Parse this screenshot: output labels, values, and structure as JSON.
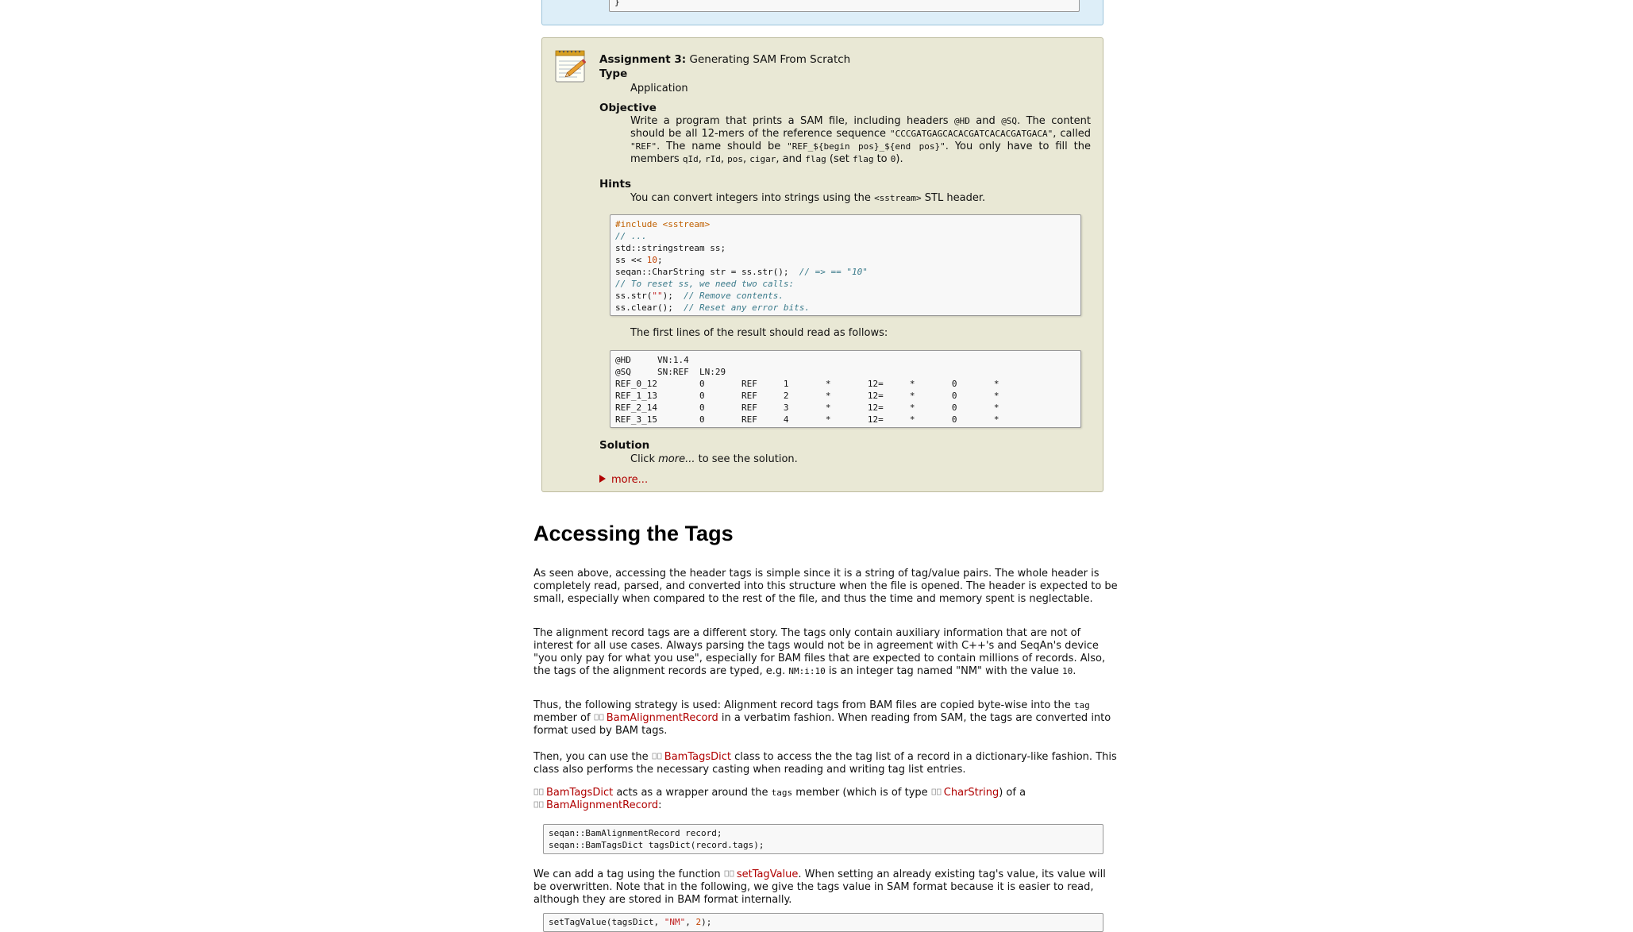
{
  "prev_code": {
    "closing": "}"
  },
  "assignment": {
    "title_bold": "Assignment 3:",
    "title_rest": " Generating SAM From Scratch",
    "type_label": "Type",
    "type_value": "Application",
    "objective_label": "Objective",
    "objective": {
      "t1": "Write a program that prints a SAM file, including headers ",
      "c1": "@HD",
      "t2": " and ",
      "c2": "@SQ",
      "t3": ". The content should be all 12-mers of the reference sequence ",
      "c3": "\"CCCGATGAGCACACGATCACACGATGACA\"",
      "t4": ", called ",
      "c4": "\"REF\"",
      "t5": ". The name should be ",
      "c5": "\"REF_${begin pos}_${end pos}\"",
      "t6": ". You only have to fill the members ",
      "c6": "qId",
      "t7": ", ",
      "c7": "rId",
      "t8": ", ",
      "c8": "pos",
      "t9": ", ",
      "c9": "cigar",
      "t10": ", and ",
      "c10": "flag",
      "t11": " (set ",
      "c11": "flag",
      "t12": " to ",
      "c12": "0",
      "t13": ")."
    },
    "hints_label": "Hints",
    "hints": {
      "t1": "You can convert integers into strings using the ",
      "c1": "<sstream>",
      "t2": " STL header."
    },
    "code1": {
      "l1": "#include <sstream>",
      "l2": "// ...",
      "l3": "std::stringstream ss;",
      "l4a": "ss << ",
      "l4n": "10",
      "l4b": ";",
      "l5a": "seqan::CharString str = ss.str();  ",
      "l5c": "// => == \"10\"",
      "l6": "// To reset ss, we need two calls:",
      "l7a": "ss.str(",
      "l7s": "\"\"",
      "l7b": ");  ",
      "l7c": "// Remove contents.",
      "l8a": "ss.clear();  ",
      "l8c": "// Reset any error bits."
    },
    "result_intro": "The first lines of the result should read as follows:",
    "result_lines": [
      "@HD\tVN:1.4",
      "@SQ\tSN:REF\tLN:29",
      "REF_0_12\t0\tREF\t1\t*\t12=\t*\t0\t*",
      "REF_1_13\t0\tREF\t2\t*\t12=\t*\t0\t*",
      "REF_2_14\t0\tREF\t3\t*\t12=\t*\t0\t*",
      "REF_3_15\t0\tREF\t4\t*\t12=\t*\t0\t*"
    ],
    "solution_label": "Solution",
    "solution": {
      "t1": "Click ",
      "em": "more...",
      "t2": " to see the solution."
    },
    "more_link": "more..."
  },
  "section": {
    "heading": "Accessing the Tags",
    "p1": "As seen above, accessing the header tags is simple since it is a string of tag/value pairs. The whole header is completely read, parsed, and converted into this structure when the file is opened. The header is expected to be small, especially when compared to the rest of the file, and thus the time and memory spent is neglectable.",
    "p2": {
      "t1": "The alignment record tags are a different story. The tags only contain auxiliary information that are not of interest for all use cases. Always parsing the tags would not be in agreement with C++'s and SeqAn's device \"you only pay for what you use\", especially for BAM files that are expected to contain millions of records. Also, the tags of the alignment records are typed, e.g. ",
      "c1": "NM:i:10",
      "t2": " is an integer tag named \"NM\" with the value ",
      "c2": "10",
      "t3": "."
    },
    "p3": {
      "t1": "Thus, the following strategy is used: Alignment record tags from BAM files are copied byte-wise into the ",
      "c1": "tag",
      "t2": " member of ",
      "link1": "BamAlignmentRecord",
      "t3": " in a verbatim fashion. When reading from SAM, the tags are converted into format used by BAM tags."
    },
    "p4": {
      "t1": "Then, you can use the ",
      "link1": "BamTagsDict",
      "t2": " class to access the the tag list of a record in a dictionary-like fashion. This class also performs the necessary casting when reading and writing tag list entries."
    },
    "p5": {
      "link1": "BamTagsDict",
      "t1": " acts as a wrapper around the ",
      "c1": "tags",
      "t2": " member (which is of type ",
      "link2": "CharString",
      "t3": ") of a ",
      "link3": "BamAlignmentRecord",
      "t4": ":"
    },
    "code2": {
      "l1": "seqan::BamAlignmentRecord record;",
      "l2": "seqan::BamTagsDict tagsDict(record.tags);"
    },
    "p6": {
      "t1": "We can add a tag using the function ",
      "link1": "setTagValue",
      "t2": ". When setting an already existing tag's value, its value will be overwritten. Note that in the following, we give the tags value in SAM format because it is easier to read, although they are stored in BAM format internally."
    },
    "code3": {
      "a": "setTagValue(tagsDict, ",
      "s": "\"NM\"",
      "b": ", ",
      "n": "2",
      "c": ");"
    }
  }
}
